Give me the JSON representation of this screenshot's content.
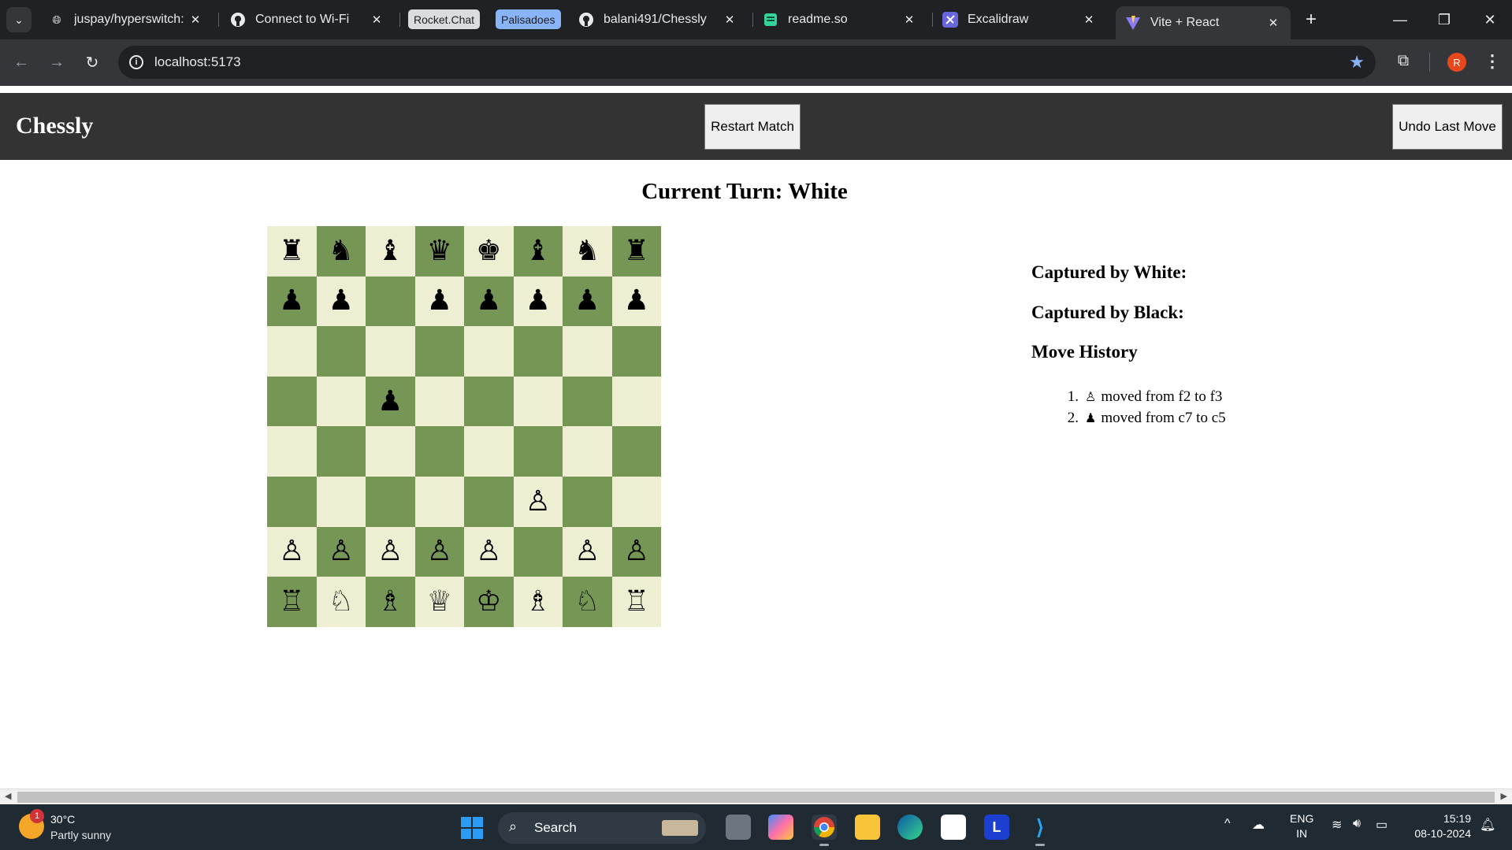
{
  "browser": {
    "tabs": [
      {
        "title": "juspay/hyperswitch: A",
        "icon": "globe-icon"
      },
      {
        "title": "Connect to Wi-Fi",
        "icon": "github-icon"
      },
      {
        "title": "balani491/Chessly",
        "icon": "github-icon"
      },
      {
        "title": "readme.so",
        "icon": "readme-icon"
      },
      {
        "title": "Excalidraw",
        "icon": "excalidraw-icon"
      },
      {
        "title": "Vite + React",
        "icon": "vite-icon"
      }
    ],
    "groups": [
      {
        "label": "Rocket.Chat",
        "color": "#dadce0"
      },
      {
        "label": "Palisadoes",
        "color": "#8ab4f8"
      }
    ],
    "url": "localhost:5173",
    "profile_initial": "R"
  },
  "app": {
    "title": "Chessly",
    "restart_label": "Restart Match",
    "undo_label": "Undo Last Move",
    "turn_text": "Current Turn: White",
    "captured_white_label": "Captured by White:",
    "captured_black_label": "Captured by Black:",
    "history_label": "Move History",
    "board": [
      [
        "♜",
        "♞",
        "♝",
        "♛",
        "♚",
        "♝",
        "♞",
        "♜"
      ],
      [
        "♟",
        "♟",
        "",
        "♟",
        "♟",
        "♟",
        "♟",
        "♟"
      ],
      [
        "",
        "",
        "",
        "",
        "",
        "",
        "",
        ""
      ],
      [
        "",
        "",
        "♟",
        "",
        "",
        "",
        "",
        ""
      ],
      [
        "",
        "",
        "",
        "",
        "",
        "",
        "",
        ""
      ],
      [
        "",
        "",
        "",
        "",
        "",
        "♙",
        "",
        ""
      ],
      [
        "♙",
        "♙",
        "♙",
        "♙",
        "♙",
        "",
        "♙",
        "♙"
      ],
      [
        "♖",
        "♘",
        "♗",
        "♕",
        "♔",
        "♗",
        "♘",
        "♖"
      ]
    ],
    "moves": [
      {
        "num": "1.",
        "piece": "♙",
        "text": "moved from f2 to f3"
      },
      {
        "num": "2.",
        "piece": "♟",
        "text": "moved from c7 to c5"
      }
    ],
    "colors": {
      "light_square": "#eeeed2",
      "dark_square": "#769656",
      "header_bg": "#333333"
    }
  },
  "taskbar": {
    "weather_temp": "30°C",
    "weather_desc": "Partly sunny",
    "weather_badge": "1",
    "search_label": "Search",
    "lang_line1": "ENG",
    "lang_line2": "IN",
    "time": "15:19",
    "date": "08-10-2024"
  }
}
